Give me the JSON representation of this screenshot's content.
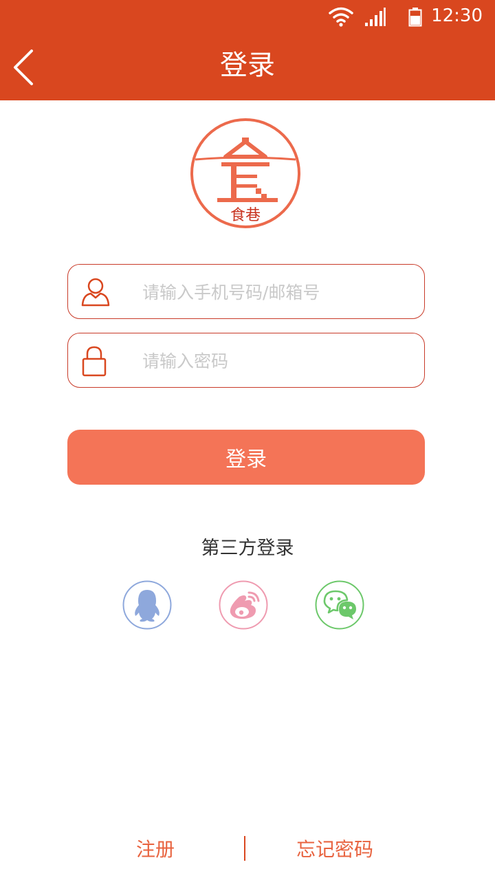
{
  "status_bar": {
    "time": "12:30"
  },
  "header": {
    "title": "登录"
  },
  "logo": {
    "text": "食巷"
  },
  "form": {
    "account_placeholder": "请输入手机号码/邮箱号",
    "password_placeholder": "请输入密码",
    "login_label": "登录"
  },
  "third_party": {
    "title": "第三方登录",
    "items": [
      {
        "icon": "qq-icon",
        "color": "#8ea8dc"
      },
      {
        "icon": "weibo-icon",
        "color": "#ef9bb0"
      },
      {
        "icon": "wechat-icon",
        "color": "#6cc86a"
      }
    ]
  },
  "footer": {
    "register_label": "注册",
    "forgot_password_label": "忘记密码"
  },
  "colors": {
    "header": "#d9471f",
    "button": "#f47457",
    "field_border": "#c83a28",
    "footer_text": "#e8633f"
  }
}
